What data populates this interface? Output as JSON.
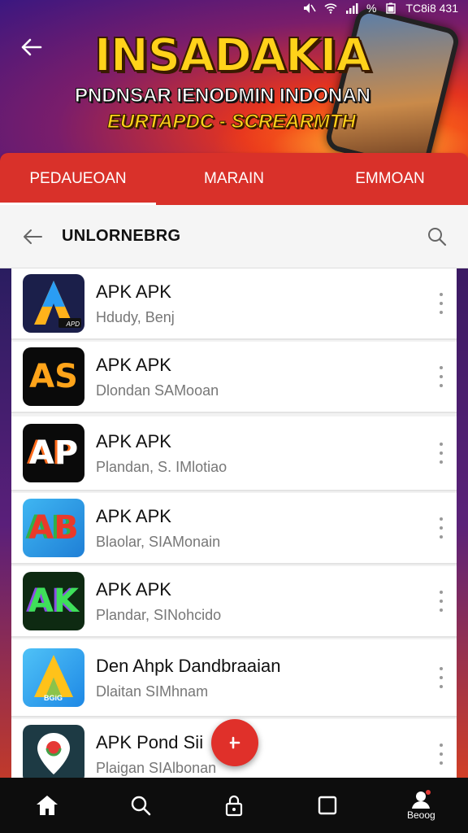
{
  "status_bar": {
    "time": "TC8i8 431",
    "percent": "%"
  },
  "banner": {
    "title": "INSADAKIA",
    "subtitle": "PNDNSAR IENODMIN INDONAN",
    "tagline": "EURTAPDC - SCREARMTH"
  },
  "tabs": [
    {
      "label": "PEDAUEOAN",
      "active": true
    },
    {
      "label": "MARAIN",
      "active": false
    },
    {
      "label": "EMMOAN",
      "active": false
    }
  ],
  "header": {
    "title": "UNLORNEBRG"
  },
  "apps": [
    {
      "title": "APK APK",
      "subtitle": "Hdudy, Benj",
      "icon": "app-icon-a-blue",
      "glyph": "A",
      "badge": "APD"
    },
    {
      "title": "APK APK",
      "subtitle": "Dlondan SAMooan",
      "icon": "app-icon-as-black",
      "glyph": "AS"
    },
    {
      "title": "APK APK",
      "subtitle": "Plandan, S. IMlotiao",
      "icon": "app-icon-ap-black",
      "glyph": "AP"
    },
    {
      "title": "APK APK",
      "subtitle": "Blaolar, SIAMonain",
      "icon": "app-icon-ab-blue",
      "glyph": "AB"
    },
    {
      "title": "APK APK",
      "subtitle": "Plandar, SINohcido",
      "icon": "app-icon-ak-green",
      "glyph": "AK"
    },
    {
      "title": "Den Ahpk Dandbraaian",
      "subtitle": "Dlaitan SIMhnam",
      "icon": "app-icon-a-yellow",
      "glyph": "A",
      "badge": "BGiG"
    },
    {
      "title": "APK Pond Sii",
      "subtitle": "Plaigan SIAlbonan",
      "icon": "app-icon-map-pin",
      "glyph": ""
    }
  ],
  "bottom_nav": [
    {
      "icon": "home-icon",
      "label": ""
    },
    {
      "icon": "search-icon",
      "label": ""
    },
    {
      "icon": "lock-icon",
      "label": ""
    },
    {
      "icon": "square-icon",
      "label": ""
    },
    {
      "icon": "profile-icon",
      "label": "Beoog"
    }
  ],
  "colors": {
    "accent": "#d9312a",
    "title_yellow": "#ffd21a"
  }
}
